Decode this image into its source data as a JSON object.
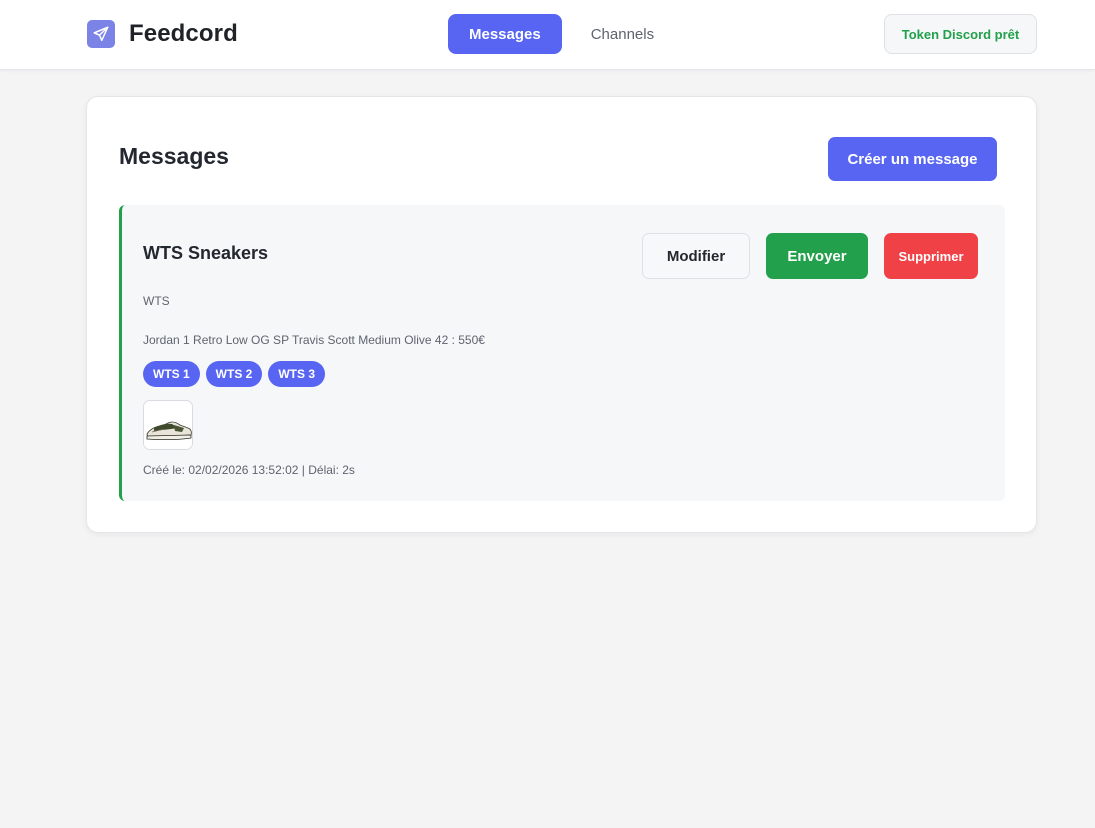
{
  "app": {
    "name": "Feedcord",
    "brand_icon": "paper-plane-icon"
  },
  "nav": {
    "tabs": [
      {
        "label": "Messages",
        "active": true
      },
      {
        "label": "Channels",
        "active": false
      }
    ]
  },
  "status": {
    "token_label": "Token Discord prêt",
    "color": "#22a04b"
  },
  "page": {
    "title": "Messages",
    "create_label": "Créer un message"
  },
  "messages": [
    {
      "title": "WTS Sneakers",
      "prefix": "WTS",
      "body": "Jordan 1 Retro Low OG SP Travis Scott Medium Olive 42 : 550€",
      "tags": [
        "WTS 1",
        "WTS 2",
        "WTS 3"
      ],
      "thumbnail_icon": "sneaker-image",
      "meta": "Créé le: 02/02/2026 13:52:02 | Délai: 2s",
      "actions": {
        "edit_label": "Modifier",
        "send_label": "Envoyer",
        "delete_label": "Supprimer"
      }
    }
  ],
  "colors": {
    "accent": "#5865f2",
    "success": "#22a04b",
    "danger": "#ef4146"
  }
}
